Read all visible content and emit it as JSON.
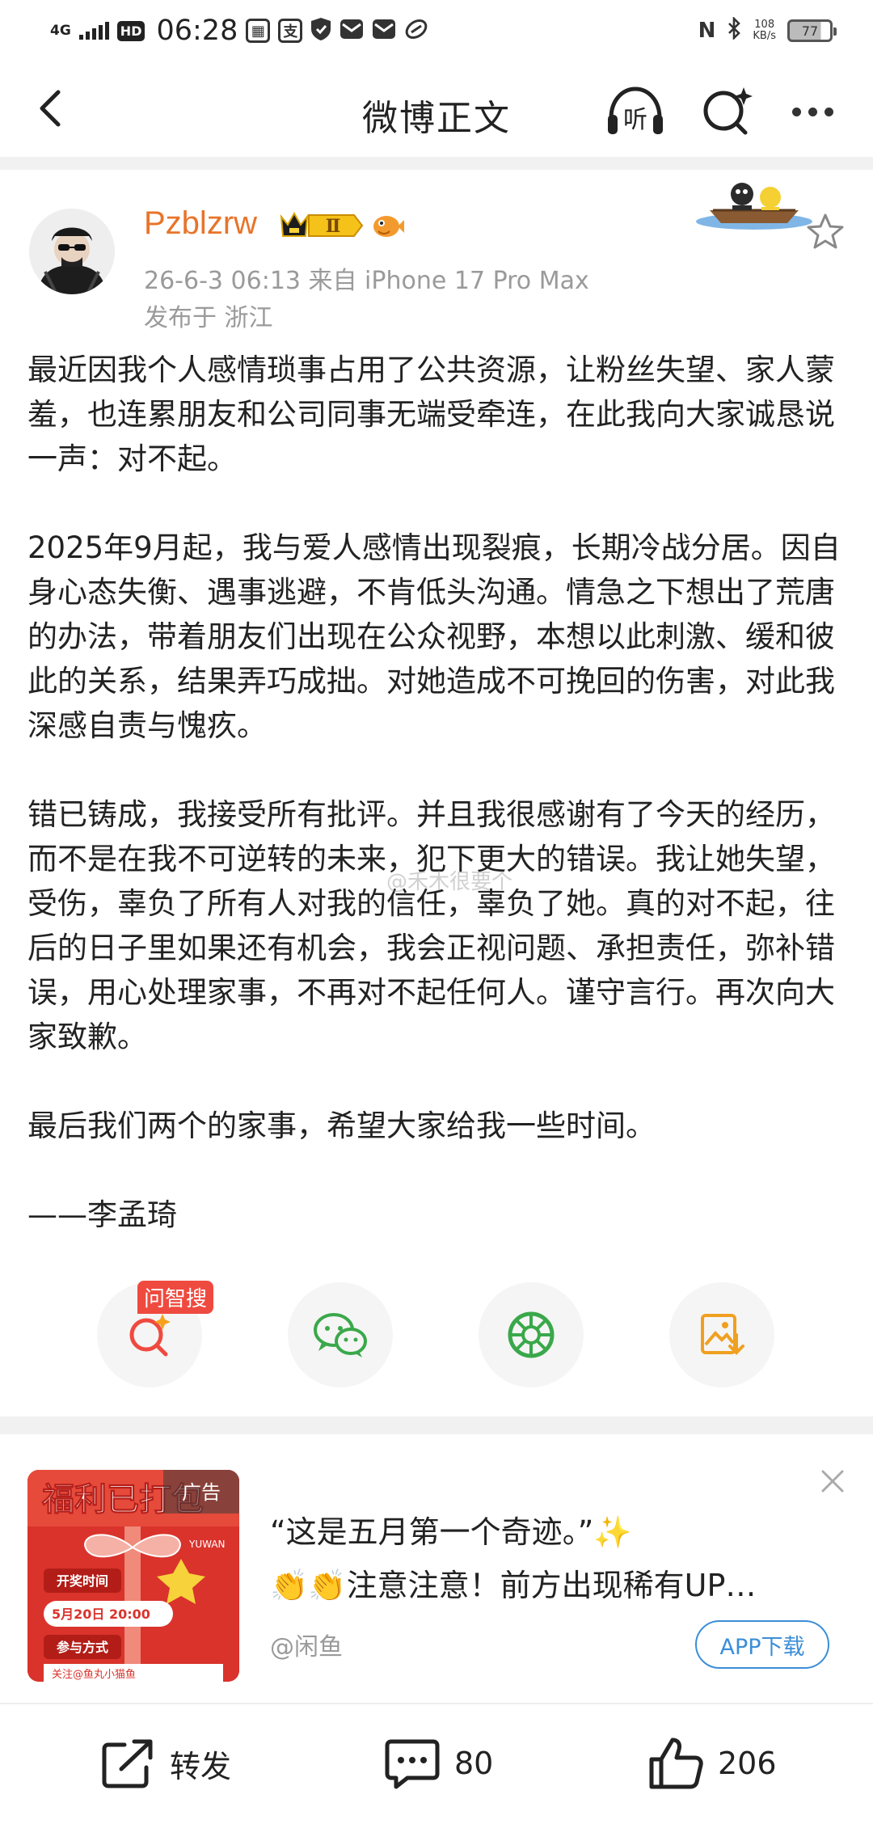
{
  "status_bar": {
    "network": "4G",
    "hd": "HD",
    "time": "06:28",
    "app_icons": [
      "qr-icon",
      "pay-icon",
      "shield-icon",
      "mail-icon",
      "mail-icon",
      "link-icon"
    ],
    "pay_glyph": "支",
    "speed_value": "108",
    "speed_unit": "KB/s",
    "battery": "77"
  },
  "header": {
    "title": "微博正文",
    "listen_label": "听"
  },
  "post": {
    "username": "Pzblzrw",
    "vip_level": "Ⅱ",
    "meta": "26-6-3 06:13  来自 iPhone 17 Pro Max",
    "location": "发布于 浙江",
    "paragraphs": [
      "最近因我个人感情琐事占用了公共资源，让粉丝失望、家人蒙羞，也连累朋友和公司同事无端受牵连，在此我向大家诚恳说一声：对不起。",
      "2025年9月起，我与爱人感情出现裂痕，长期冷战分居。因自身心态失衡、遇事逃避，不肯低头沟通。情急之下想出了荒唐的办法，带着朋友们出现在公众视野，本想以此刺激、缓和彼此的关系，结果弄巧成拙。对她造成不可挽回的伤害，对此我深感自责与愧疚。",
      "错已铸成，我接受所有批评。并且我很感谢有了今天的经历，而不是在我不可逆转的未来，犯下更大的错误。我让她失望，受伤，辜负了所有人对我的信任，辜负了她。真的对不起，往后的日子里如果还有机会，我会正视问题、承担责任，弥补错误，用心处理家事，不再对不起任何人。谨守言行。再次向大家致歉。",
      "最后我们两个的家事，希望大家给我一些时间。"
    ],
    "signature": "——李孟琦",
    "watermark": "@禾木很要个"
  },
  "share": {
    "ai_tag": "问智搜"
  },
  "ad": {
    "thumb_title": "福利已打包",
    "thumb_tag": "广告",
    "thumb_brand": "YUWAN",
    "thumb_row1": "开奖时间",
    "thumb_date": "5月20日 20:00",
    "thumb_row2": "参与方式",
    "thumb_row3": "关注@鱼丸小猫鱼",
    "line1": "“这是五月第一个奇迹。”✨",
    "line2": "👏👏注意注意！前方出现稀有UP…",
    "source": "@闲鱼",
    "button": "APP下载"
  },
  "bottom_bar": {
    "repost_label": "转发",
    "comment_count": "80",
    "like_count": "206"
  },
  "colors": {
    "username": "#e8742a",
    "meta": "#9a9a9a",
    "wechat": "#3aa84a",
    "moments": "#3aa84a",
    "save": "#f0a020",
    "ai_tag": "#ef4a3f",
    "ad_button": "#3b8ed8"
  }
}
